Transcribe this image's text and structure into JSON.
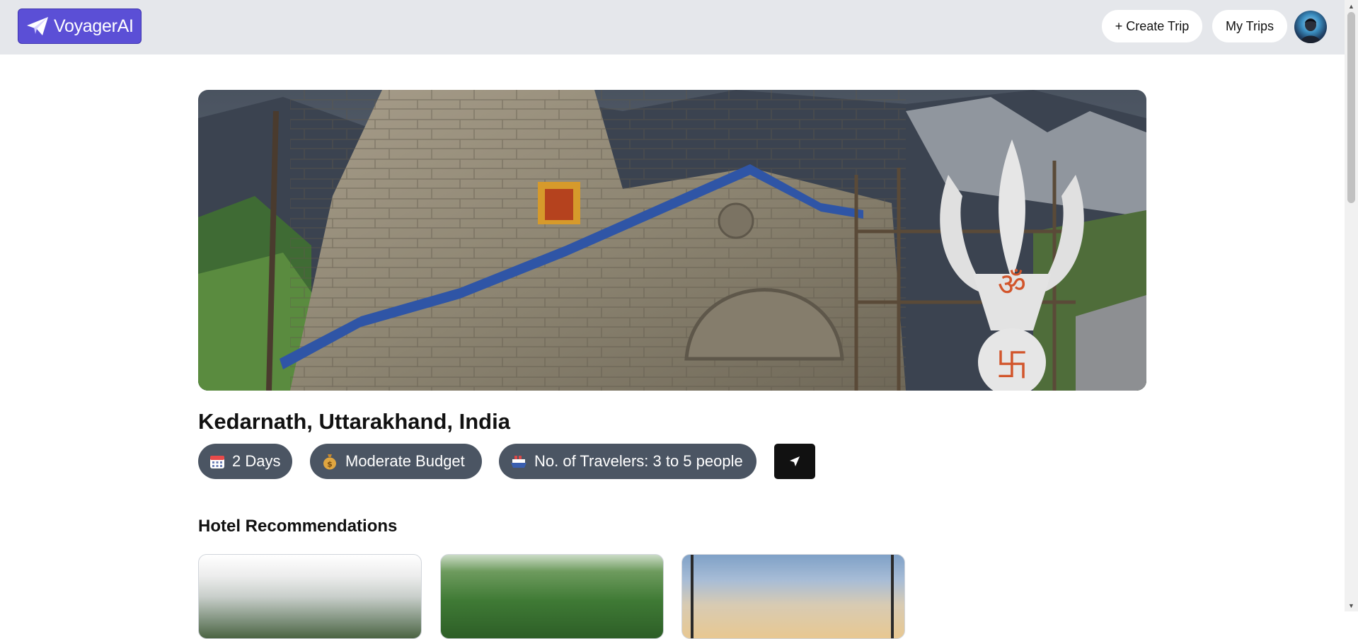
{
  "header": {
    "brand": "VoyagerAI",
    "create_trip": "+ Create Trip",
    "my_trips": "My Trips"
  },
  "trip": {
    "location": "Kedarnath, Uttarakhand, India",
    "days": "2 Days",
    "budget": "Moderate Budget",
    "travelers": "No. of Travelers: 3 to 5 people"
  },
  "sections": {
    "hotels_title": "Hotel Recommendations"
  },
  "icons": {
    "brand": "paper-plane-icon",
    "days": "calendar-icon",
    "budget": "money-bag-icon",
    "travelers": "ship-icon",
    "share": "send-icon"
  },
  "colors": {
    "brand": "#5b4fd6",
    "chip": "#4b5563",
    "share_button": "#111111"
  }
}
